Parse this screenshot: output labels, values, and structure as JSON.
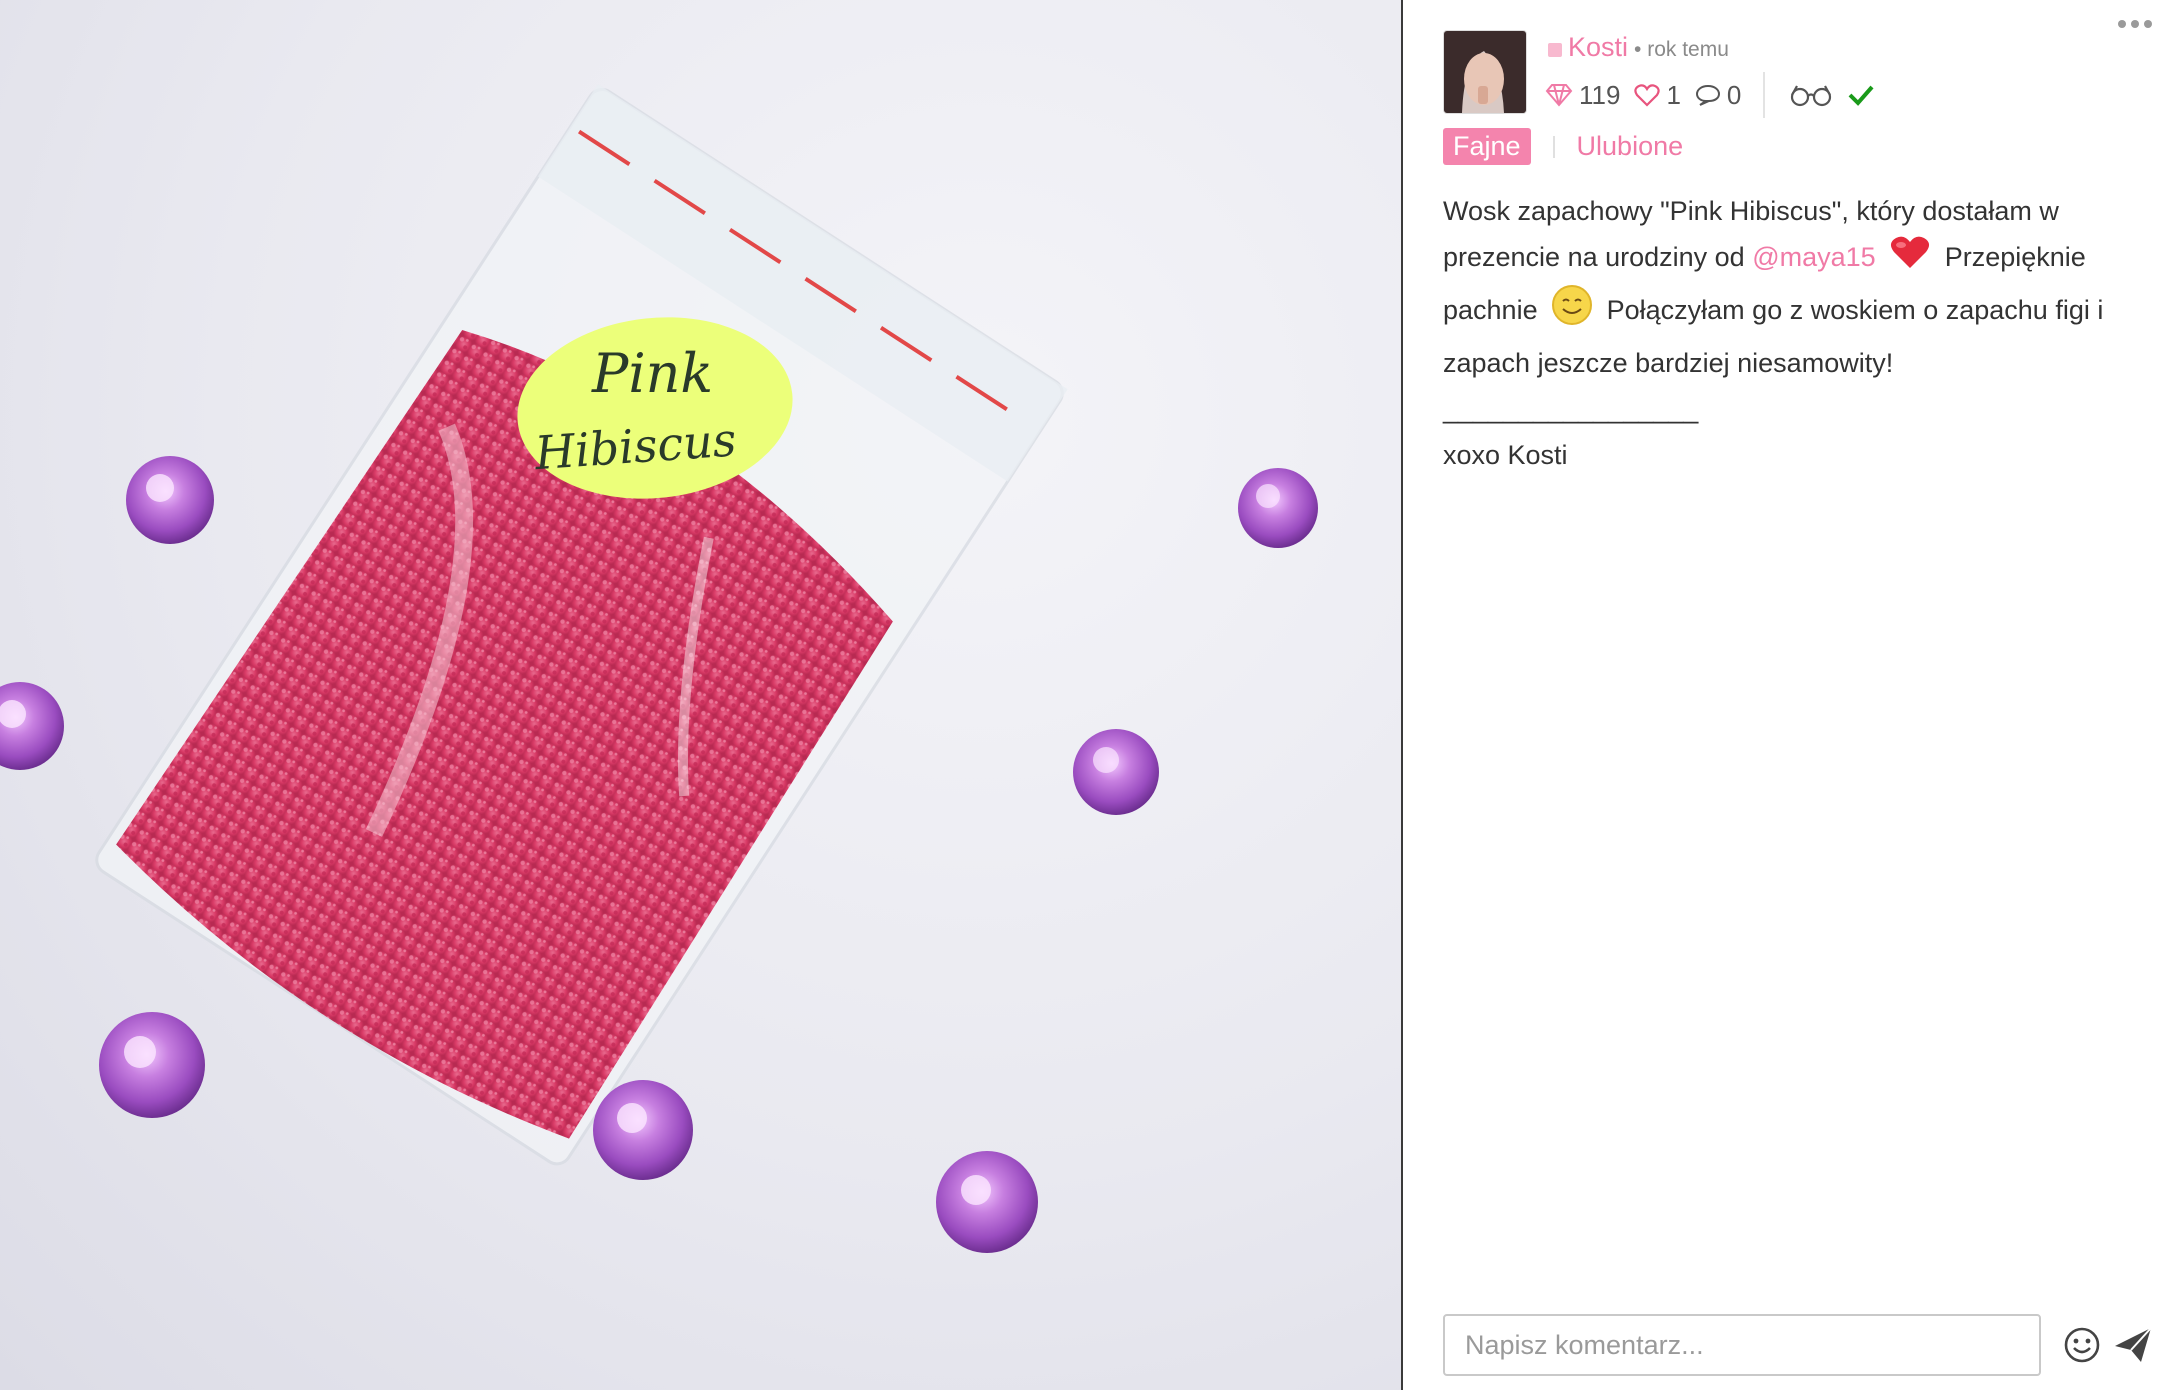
{
  "post": {
    "author": "Kosti",
    "time": "• rok temu",
    "stats": {
      "diamonds": "119",
      "likes": "1",
      "comments": "0"
    },
    "tabs": {
      "active": "Fajne",
      "other": "Ulubione"
    },
    "description": {
      "part1": "Wosk zapachowy \"Pink Hibiscus\", który dostałam w prezencie na urodziny od",
      "mention": "@maya15",
      "part2": "Przepięknie pachnie",
      "part3": "Połączyłam go z woskiem o zapachu figi i zapach jeszcze bardziej niesamowity!",
      "rule": "_________________",
      "signoff": "xoxo Kosti"
    }
  },
  "photo": {
    "label_line1": "Pink",
    "label_line2": "Hibiscus"
  },
  "comment": {
    "placeholder": "Napisz komentarz..."
  },
  "icons": [
    "more-icon",
    "diamond-icon",
    "heart-icon",
    "comment-icon",
    "glasses-icon",
    "check-icon",
    "heart-emoji-icon",
    "smile-emoji-icon",
    "emoji-icon",
    "send-icon"
  ],
  "colors": {
    "accent": "#f07aa6",
    "tab_active": "#f484ad",
    "check": "#1a9a1a"
  }
}
